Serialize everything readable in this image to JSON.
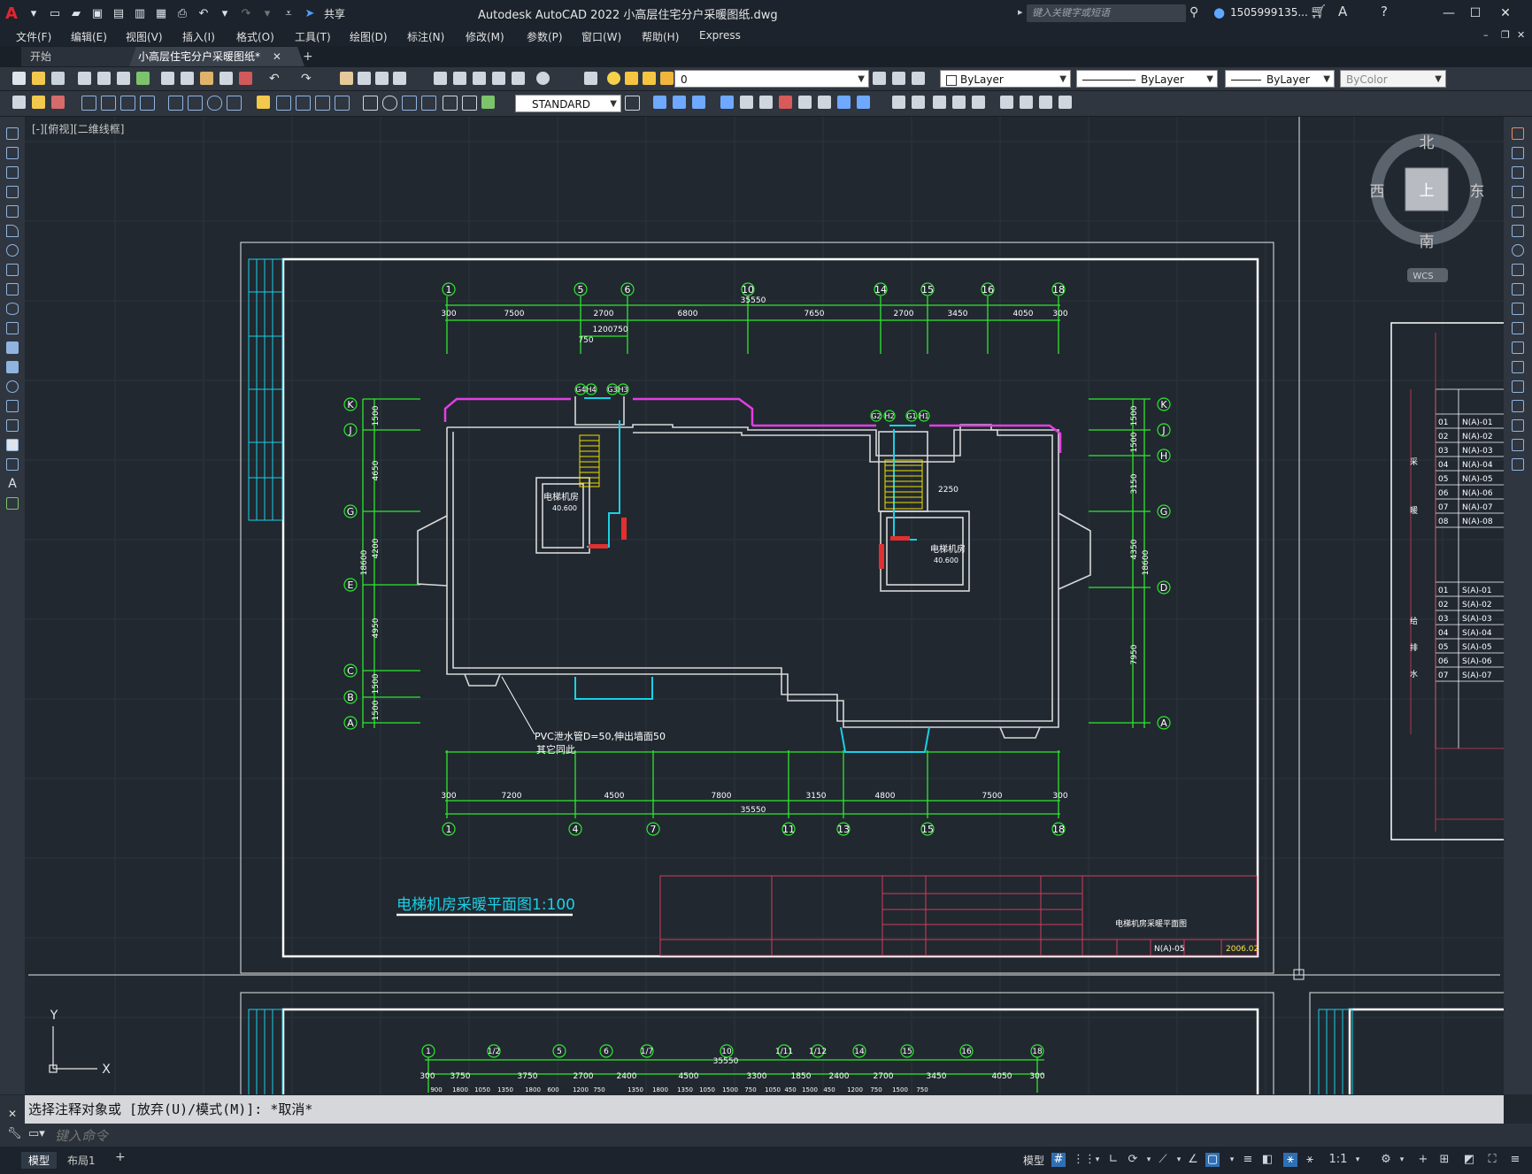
{
  "app": {
    "title": "Autodesk AutoCAD 2022    小高层住宅分户采暖图纸.dwg",
    "search_placeholder": "键入关键字或短语",
    "user": "1505999135...",
    "share": "共享",
    "logo": "A"
  },
  "menu": [
    "文件(F)",
    "编辑(E)",
    "视图(V)",
    "插入(I)",
    "格式(O)",
    "工具(T)",
    "绘图(D)",
    "标注(N)",
    "修改(M)",
    "参数(P)",
    "窗口(W)",
    "帮助(H)",
    "Express"
  ],
  "tabs": {
    "start": "开始",
    "active": "小高层住宅分户采暖图纸*",
    "add": "+"
  },
  "toolbar": {
    "layer_value": "0",
    "text_style": "STANDARD",
    "color": "ByLayer",
    "linetype": "ByLayer",
    "lineweight": "ByLayer",
    "plotstyle": "ByColor"
  },
  "viewport": {
    "label": "[-][俯视][二维线框]"
  },
  "viewcube": {
    "north": "北",
    "south": "南",
    "east": "东",
    "west": "西",
    "top": "上",
    "wcs": "WCS"
  },
  "ucs": {
    "x": "X",
    "y": "Y"
  },
  "drawing": {
    "plan_title": "电梯机房采暖平面图1:100",
    "top_axes": [
      "1",
      "5",
      "6",
      "10",
      "14",
      "15",
      "16",
      "18"
    ],
    "top_dims": [
      "300",
      "7500",
      "2700",
      "6800",
      "7650",
      "2700",
      "3450",
      "4050",
      "300"
    ],
    "top_total": "35550",
    "top_sub": [
      "1200",
      "750",
      "750"
    ],
    "bottom_axes": [
      "1",
      "4",
      "7",
      "11",
      "13",
      "15",
      "18"
    ],
    "bottom_dims": [
      "300",
      "7200",
      "4500",
      "7800",
      "3150",
      "4800",
      "7500",
      "300"
    ],
    "bottom_total": "35550",
    "left_axes": [
      "K",
      "J",
      "G",
      "E",
      "C",
      "B",
      "A"
    ],
    "left_dims": [
      "1500",
      "4650",
      "4200",
      "4950",
      "1500",
      "1500"
    ],
    "left_total": "18600",
    "right_axes": [
      "K",
      "J",
      "H",
      "G",
      "D",
      "A"
    ],
    "right_dims": [
      "1500",
      "1500",
      "3150",
      "4350",
      "7950"
    ],
    "right_total": "18600",
    "stair_tags_left": [
      "G4",
      "H4",
      "G3",
      "H3"
    ],
    "stair_tags_right": [
      "G2",
      "H2",
      "G1",
      "H1"
    ],
    "room_left": "电梯机房",
    "room_left_elev": "40.600",
    "room_right": "电梯机房",
    "room_right_elev": "40.600",
    "dim_2250": "2250",
    "note_line1": "PVC泄水管D=50,伸出墙面50",
    "note_line2": "其它同此",
    "titleblock_drawing_no": "N(A)-05",
    "titleblock_date": "2006.02",
    "titleblock_name": "电梯机房采暖平面图",
    "next_axes": [
      "1",
      "1/2",
      "5",
      "6",
      "1/7",
      "10",
      "1/11",
      "1/12",
      "14",
      "15",
      "16",
      "18"
    ],
    "next_dims": [
      "300",
      "3750",
      "3750",
      "2700",
      "2400",
      "4500",
      "3300",
      "1850",
      "2400",
      "2700",
      "3450",
      "4050",
      "300"
    ],
    "next_total": "35550",
    "next_sub": [
      "900",
      "1800",
      "1050",
      "1350",
      "1800",
      "600",
      "1200",
      "750",
      "1350",
      "1800",
      "1350",
      "1050",
      "1500",
      "750",
      "1050",
      "450",
      "1500",
      "450",
      "1200",
      "750",
      "1500",
      "750"
    ]
  },
  "side_table": {
    "group1_label": "采",
    "group1_label2": "暖",
    "group2_label": "给",
    "group2_label2": "排",
    "group2_label3": "水",
    "nums1": [
      "01",
      "02",
      "03",
      "04",
      "05",
      "06",
      "07",
      "08"
    ],
    "codes1": [
      "N(A)-01",
      "N(A)-02",
      "N(A)-03",
      "N(A)-04",
      "N(A)-05",
      "N(A)-06",
      "N(A)-07",
      "N(A)-08"
    ],
    "nums2": [
      "01",
      "02",
      "03",
      "04",
      "05",
      "06",
      "07"
    ],
    "codes2": [
      "S(A)-01",
      "S(A)-02",
      "S(A)-03",
      "S(A)-04",
      "S(A)-05",
      "S(A)-06",
      "S(A)-07"
    ]
  },
  "command": {
    "history": "选择注释对象或 [放弃(U)/模式(M)]: *取消*",
    "placeholder": "键入命令"
  },
  "status": {
    "model_tab": "模型",
    "layout_tab": "布局1",
    "model_label": "模型",
    "scale": "1:1"
  }
}
